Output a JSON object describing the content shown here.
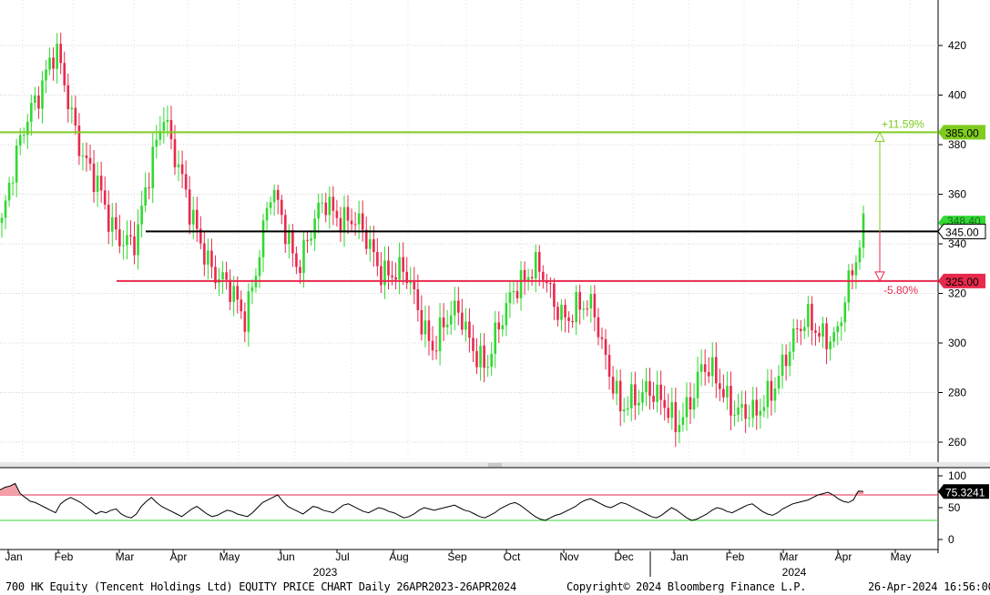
{
  "footer": {
    "left": "700 HK Equity (Tencent Holdings Ltd) EQUITY PRICE CHART  Daily 26APR2023-26APR2024",
    "center": "Copyright© 2024 Bloomberg Finance L.P.",
    "right": "26-Apr-2024 16:56:00"
  },
  "chart_data": [
    {
      "type": "candlestick",
      "title": "",
      "ylim": [
        250,
        440
      ],
      "y_ticks": [
        260,
        280,
        300,
        320,
        340,
        360,
        380,
        400,
        420
      ],
      "grid": true,
      "x_months": [
        "Jan",
        "Feb",
        "Mar",
        "Apr",
        "May",
        "Jun",
        "Jul",
        "Aug",
        "Sep",
        "Oct",
        "Nov",
        "Dec",
        "Jan",
        "Feb",
        "Mar",
        "Apr",
        "May"
      ],
      "x_years": [
        "2023",
        "2024"
      ],
      "colors": {
        "up": "#33d833",
        "down": "#e8294d"
      },
      "price_points": [
        {
          "month": "Jan",
          "close": 348
        },
        {
          "month": "Jan",
          "close": 395
        },
        {
          "month": "Jan",
          "close": 416
        },
        {
          "month": "Feb",
          "close": 378
        },
        {
          "month": "Feb",
          "close": 348
        },
        {
          "month": "Mar",
          "close": 340
        },
        {
          "month": "Mar",
          "close": 396
        },
        {
          "month": "Apr",
          "close": 350
        },
        {
          "month": "May",
          "close": 328
        },
        {
          "month": "May",
          "close": 310
        },
        {
          "month": "Jun",
          "close": 360
        },
        {
          "month": "Jun",
          "close": 333
        },
        {
          "month": "Jul",
          "close": 356
        },
        {
          "month": "Jul",
          "close": 350
        },
        {
          "month": "Aug",
          "close": 332
        },
        {
          "month": "Aug",
          "close": 326
        },
        {
          "month": "Sep",
          "close": 300
        },
        {
          "month": "Sep",
          "close": 313
        },
        {
          "month": "Oct",
          "close": 288
        },
        {
          "month": "Oct",
          "close": 325
        },
        {
          "month": "Nov",
          "close": 328
        },
        {
          "month": "Nov",
          "close": 310
        },
        {
          "month": "Dec",
          "close": 315
        },
        {
          "month": "Dec",
          "close": 270
        },
        {
          "month": "Jan",
          "close": 285
        },
        {
          "month": "Jan",
          "close": 265
        },
        {
          "month": "Feb",
          "close": 290
        },
        {
          "month": "Feb",
          "close": 278
        },
        {
          "month": "Mar",
          "close": 268
        },
        {
          "month": "Mar",
          "close": 293
        },
        {
          "month": "Apr",
          "close": 310
        },
        {
          "month": "Apr",
          "close": 300
        },
        {
          "month": "Apr",
          "close": 349
        }
      ],
      "hlines": [
        {
          "value": 385.0,
          "label": "385.00",
          "color": "#7fcc1f"
        },
        {
          "value": 345.0,
          "label": "345.00",
          "color": "#000000"
        },
        {
          "value": 325.0,
          "label": "325.00",
          "color": "#e8294d"
        }
      ],
      "last_price_label": "348.40",
      "annotations": [
        {
          "text": "+11.59%",
          "color": "#7fcc1f"
        },
        {
          "text": "-5.80%",
          "color": "#e8294d"
        }
      ]
    },
    {
      "type": "line",
      "ylim": [
        -5,
        115
      ],
      "y_ticks": [
        0,
        50,
        100
      ],
      "levels": [
        {
          "value": 70,
          "color": "#e8294d"
        },
        {
          "value": 30,
          "color": "#33d833"
        }
      ],
      "last_value_label": "75.3241",
      "values": [
        78,
        82,
        84,
        88,
        72,
        66,
        60,
        58,
        54,
        50,
        46,
        42,
        56,
        62,
        66,
        62,
        58,
        52,
        46,
        40,
        44,
        42,
        46,
        48,
        40,
        36,
        34,
        40,
        52,
        60,
        66,
        58,
        52,
        48,
        44,
        40,
        36,
        42,
        48,
        52,
        46,
        40,
        36,
        38,
        42,
        46,
        44,
        40,
        38,
        36,
        42,
        50,
        58,
        62,
        66,
        70,
        60,
        52,
        48,
        44,
        40,
        46,
        52,
        50,
        46,
        44,
        42,
        48,
        54,
        56,
        52,
        48,
        44,
        42,
        46,
        50,
        48,
        44,
        42,
        38,
        34,
        36,
        40,
        46,
        50,
        48,
        46,
        48,
        50,
        52,
        54,
        50,
        46,
        44,
        40,
        36,
        34,
        38,
        42,
        48,
        52,
        56,
        58,
        54,
        48,
        42,
        36,
        32,
        30,
        34,
        38,
        40,
        44,
        48,
        52,
        58,
        62,
        64,
        60,
        56,
        52,
        50,
        54,
        58,
        56,
        52,
        48,
        44,
        40,
        36,
        34,
        38,
        44,
        50,
        46,
        40,
        34,
        30,
        32,
        36,
        40,
        46,
        50,
        48,
        44,
        42,
        46,
        50,
        54,
        56,
        50,
        44,
        40,
        38,
        42,
        48,
        52,
        56,
        58,
        60,
        62,
        66,
        70,
        72,
        74,
        70,
        64,
        60,
        58,
        62,
        76,
        75.3
      ]
    }
  ]
}
